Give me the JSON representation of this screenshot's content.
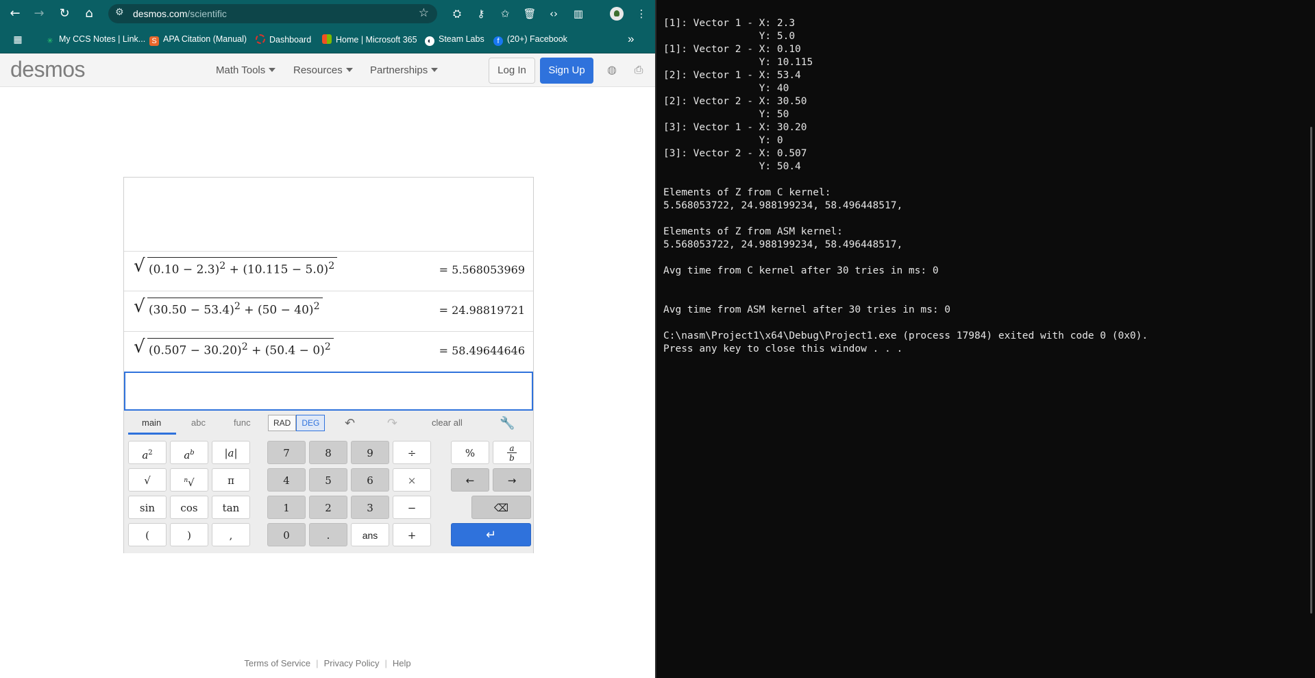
{
  "browser": {
    "url_domain": "desmos.com",
    "url_path": "/scientific",
    "bookmarks": [
      {
        "label": "My CCS Notes | Link...",
        "color": "#2ecc71"
      },
      {
        "label": "APA Citation (Manual)",
        "color": "#e8672b"
      },
      {
        "label": "Dashboard",
        "color": "#d9342b"
      },
      {
        "label": "Home | Microsoft 365",
        "color": "#f25022"
      },
      {
        "label": "Steam Labs",
        "color": "#1b2838"
      },
      {
        "label": "(20+) Facebook",
        "color": "#1877f2"
      }
    ],
    "bookmarks_more": "»"
  },
  "desmos": {
    "logo": "desmos",
    "nav": [
      "Math Tools",
      "Resources",
      "Partnerships"
    ],
    "login": "Log In",
    "signup": "Sign Up",
    "expressions": [
      {
        "a1": "0.10",
        "b1": "2.3",
        "a2": "10.115",
        "b2": "5.0",
        "result": "= 5.568053969"
      },
      {
        "a1": "30.50",
        "b1": "53.4",
        "a2": "50",
        "b2": "40",
        "result": "= 24.98819721"
      },
      {
        "a1": "0.507",
        "b1": "30.20",
        "a2": "50.4",
        "b2": "0",
        "result": "= 58.49644646"
      }
    ],
    "keypad": {
      "tabs": [
        "main",
        "abc",
        "func"
      ],
      "rad": "RAD",
      "deg": "DEG",
      "clear_all": "clear all",
      "row1": [
        "7",
        "8",
        "9",
        "÷",
        "%"
      ],
      "row2": [
        "√",
        "π",
        "4",
        "5",
        "6",
        "×",
        "←",
        "→"
      ],
      "row3": [
        "sin",
        "cos",
        "tan",
        "1",
        "2",
        "3",
        "−"
      ],
      "row4": [
        "(",
        ")",
        ",",
        "0",
        ".",
        "ans",
        "+"
      ]
    },
    "footer": [
      "Terms of Service",
      "Privacy Policy",
      "Help"
    ]
  },
  "terminal": {
    "lines": [
      "[1]: Vector 1 - X: 2.3",
      "                Y: 5.0",
      "[1]: Vector 2 - X: 0.10",
      "                Y: 10.115",
      "[2]: Vector 1 - X: 53.4",
      "                Y: 40",
      "[2]: Vector 2 - X: 30.50",
      "                Y: 50",
      "[3]: Vector 1 - X: 30.20",
      "                Y: 0",
      "[3]: Vector 2 - X: 0.507",
      "                Y: 50.4",
      "",
      "Elements of Z from C kernel:",
      "5.568053722, 24.988199234, 58.496448517,",
      "",
      "Elements of Z from ASM kernel:",
      "5.568053722, 24.988199234, 58.496448517,",
      "",
      "Avg time from C kernel after 30 tries in ms: 0",
      "",
      "",
      "Avg time from ASM kernel after 30 tries in ms: 0",
      "",
      "C:\\nasm\\Project1\\x64\\Debug\\Project1.exe (process 17984) exited with code 0 (0x0).",
      "Press any key to close this window . . ."
    ]
  }
}
